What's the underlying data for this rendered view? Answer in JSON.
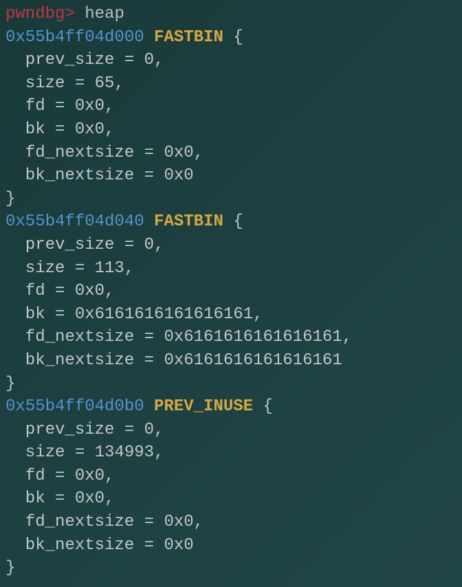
{
  "prompt": "pwndbg>",
  "command": " heap",
  "chunks": [
    {
      "address": "0x55b4ff04d000",
      "flag": " FASTBIN",
      "open_brace": " {",
      "fields": [
        "  prev_size = 0,",
        "  size = 65,",
        "  fd = 0x0,",
        "  bk = 0x0,",
        "  fd_nextsize = 0x0,",
        "  bk_nextsize = 0x0"
      ],
      "close_brace": "}"
    },
    {
      "address": "0x55b4ff04d040",
      "flag": " FASTBIN",
      "open_brace": " {",
      "fields": [
        "  prev_size = 0,",
        "  size = 113,",
        "  fd = 0x0,",
        "  bk = 0x6161616161616161,",
        "  fd_nextsize = 0x6161616161616161,",
        "  bk_nextsize = 0x6161616161616161"
      ],
      "close_brace": "}"
    },
    {
      "address": "0x55b4ff04d0b0",
      "flag": " PREV_INUSE",
      "open_brace": " {",
      "fields": [
        "  prev_size = 0,",
        "  size = 134993,",
        "  fd = 0x0,",
        "  bk = 0x0,",
        "  fd_nextsize = 0x0,",
        "  bk_nextsize = 0x0"
      ],
      "close_brace": "}"
    }
  ]
}
